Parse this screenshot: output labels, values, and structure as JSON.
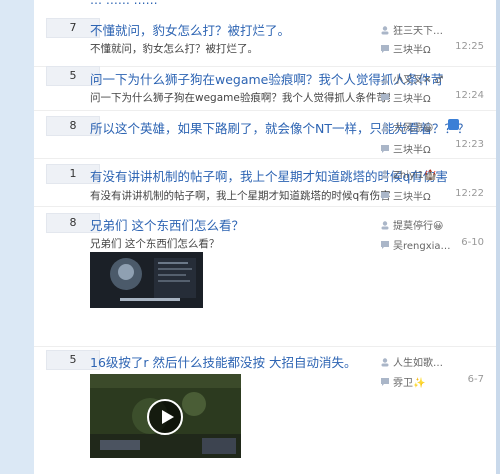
{
  "top_fragment": "…  …… ……",
  "threads": [
    {
      "count": "7",
      "title": "不懂就问，豹女怎么打？被打烂了。",
      "abstract": "不懂就问，豹女怎么打？被打烂了。",
      "author": "狂三天下…",
      "last_replier": "三块半Ω",
      "time": "12:25"
    },
    {
      "count": "5",
      "title": "问一下为什么狮子狗在wegame验痕啊？我个人觉得抓人条件苛",
      "abstract": "问一下为什么狮子狗在wegame验痕啊？我个人觉得抓人条件苛刻打团能秒c偏下的",
      "author": "小叉叉✕ ♂",
      "last_replier": "三块半Ω",
      "time": "12:24"
    },
    {
      "count": "8",
      "title": "所以这个英雄，如果下路刷了，就会像个NT一样，只能光看着？？？",
      "abstract": "",
      "author": "大风凉😀",
      "last_replier": "三块半Ω",
      "time": "12:23"
    },
    {
      "count": "1",
      "title": "有没有讲讲机制的帖子啊，我上个星期才知道跳塔的时候q有伤害",
      "abstract": "有没有讲讲机制的帖子啊，我上个星期才知道跳塔的时候q有伤害",
      "author": "Zhiyi1🏰",
      "last_replier": "三块半Ω",
      "time": "12:22"
    },
    {
      "count": "8",
      "title": "兄弟们 这个东西们怎么看？",
      "abstract": "兄弟们 这个东西们怎么看？",
      "author": "提莫停行😀",
      "last_replier": "吴rengxia…",
      "time": "6-10"
    },
    {
      "count": "5",
      "title": "16级按了r 然后什么技能都没按 大招自动消失。",
      "abstract": "",
      "author": "人生如歌…",
      "last_replier": "雰卫✨",
      "time": "6-7"
    }
  ],
  "icons": {
    "author": "user-icon",
    "replier": "reply-icon",
    "pin": "pin-icon",
    "play": "play-icon"
  },
  "colors": {
    "link": "#2d64b3",
    "bg": "#dbe8f5",
    "badge": "#eef1f6"
  }
}
